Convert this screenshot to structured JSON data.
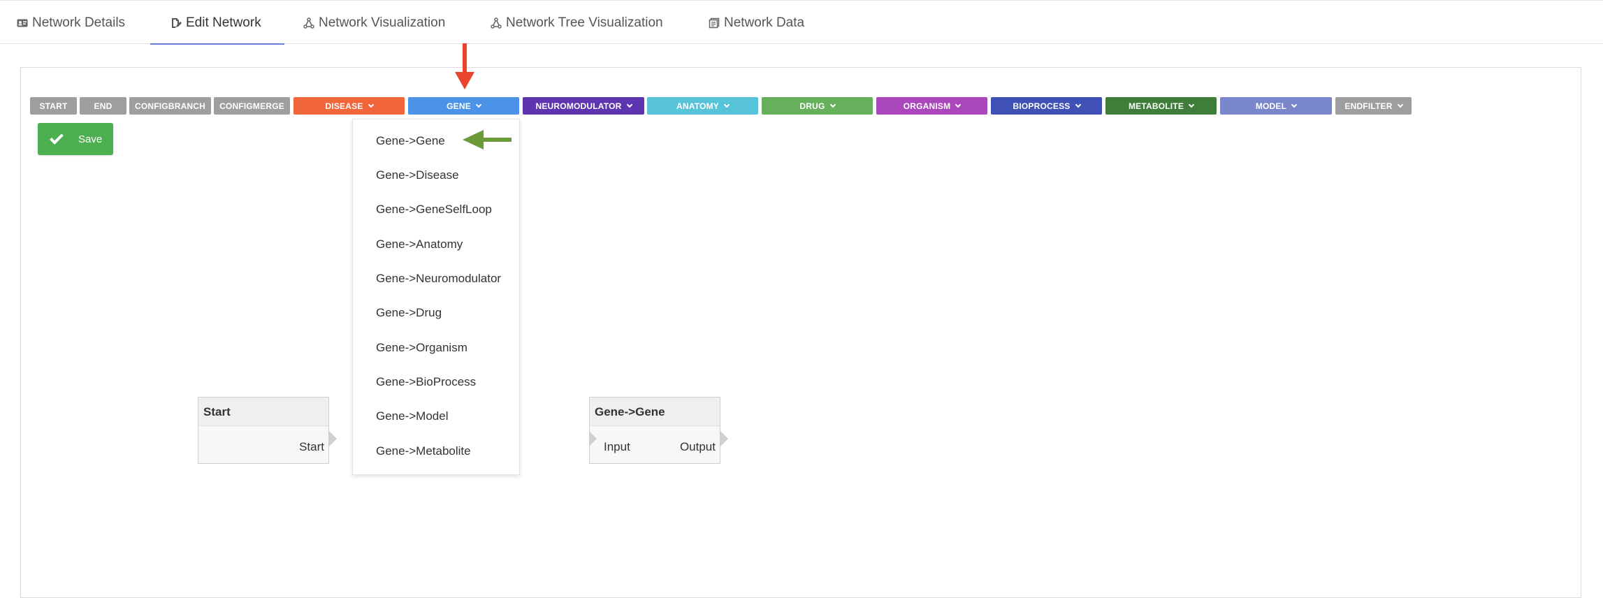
{
  "tabs": [
    {
      "label": "Network Details",
      "icon": "id-card-icon"
    },
    {
      "label": "Edit Network",
      "icon": "file-edit-icon"
    },
    {
      "label": "Network Visualization",
      "icon": "network-icon"
    },
    {
      "label": "Network Tree Visualization",
      "icon": "network-tree-icon"
    },
    {
      "label": "Network Data",
      "icon": "data-pages-icon"
    }
  ],
  "active_tab": "Edit Network",
  "toolbar": [
    {
      "label": "START",
      "color": "#9e9e9e",
      "dropdown": false
    },
    {
      "label": "END",
      "color": "#9e9e9e",
      "dropdown": false
    },
    {
      "label": "CONFIGBRANCH",
      "color": "#9e9e9e",
      "dropdown": false
    },
    {
      "label": "CONFIGMERGE",
      "color": "#9e9e9e",
      "dropdown": false
    },
    {
      "label": "DISEASE",
      "color": "#f0663a",
      "dropdown": true
    },
    {
      "label": "GENE",
      "color": "#4a93e9",
      "dropdown": true
    },
    {
      "label": "NEUROMODULATOR",
      "color": "#5e35b1",
      "dropdown": true
    },
    {
      "label": "ANATOMY",
      "color": "#56c3d9",
      "dropdown": true
    },
    {
      "label": "DRUG",
      "color": "#66b05c",
      "dropdown": true
    },
    {
      "label": "ORGANISM",
      "color": "#ab47bc",
      "dropdown": true
    },
    {
      "label": "BIOPROCESS",
      "color": "#3f51b5",
      "dropdown": true
    },
    {
      "label": "METABOLITE",
      "color": "#3f7d3a",
      "dropdown": true
    },
    {
      "label": "MODEL",
      "color": "#7986cb",
      "dropdown": true
    },
    {
      "label": "ENDFILTER",
      "color": "#9e9e9e",
      "dropdown": true
    }
  ],
  "save_label": "Save",
  "gene_menu": [
    "Gene->Gene",
    "Gene->Disease",
    "Gene->GeneSelfLoop",
    "Gene->Anatomy",
    "Gene->Neuromodulator",
    "Gene->Drug",
    "Gene->Organism",
    "Gene->BioProcess",
    "Gene->Model",
    "Gene->Metabolite"
  ],
  "nodes": {
    "start": {
      "title": "Start",
      "output_label": "Start"
    },
    "gene_gene": {
      "title": "Gene->Gene",
      "input_label": "Input",
      "output_label": "Output"
    }
  },
  "annotation_colors": {
    "red_arrow": "#e8452c",
    "green_arrow": "#6a9a3a"
  }
}
